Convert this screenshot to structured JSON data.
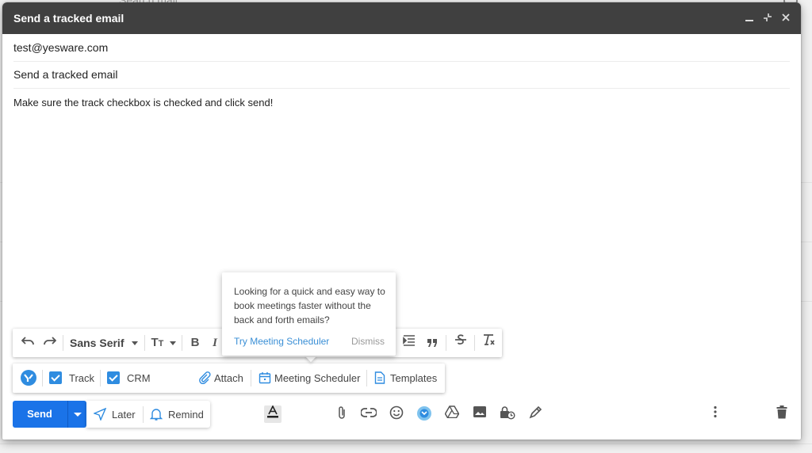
{
  "background": {
    "search_placeholder": "Search mail"
  },
  "compose": {
    "title": "Send a tracked email",
    "to": "test@yesware.com",
    "subject": "Send a tracked email",
    "body": "Make sure the track checkbox is checked and click send!"
  },
  "formatting": {
    "font": "Sans Serif",
    "bold": "B",
    "italic": "I"
  },
  "popup": {
    "text": "Looking for a quick and easy way to book meetings faster without the back and forth emails?",
    "link": "Try Meeting Scheduler",
    "dismiss": "Dismiss"
  },
  "yesware_bar": {
    "track_label": "Track",
    "track_checked": true,
    "crm_label": "CRM",
    "crm_checked": true,
    "attach_label": "Attach",
    "meeting_label": "Meeting Scheduler",
    "templates_label": "Templates"
  },
  "send_bar": {
    "send_label": "Send",
    "later_label": "Later",
    "remind_label": "Remind"
  },
  "colors": {
    "titlebar": "#404040",
    "send": "#1a73e8",
    "checkbox": "#2f8ce0",
    "link": "#3a8fd6"
  },
  "icons": [
    "undo-icon",
    "redo-icon",
    "text-size-icon",
    "indent-icon",
    "quote-icon",
    "strikethrough-icon",
    "clear-format-icon",
    "yesware-logo-icon",
    "paperclip-icon",
    "calendar-icon",
    "document-icon",
    "send-later-icon",
    "bell-icon",
    "text-color-icon",
    "attach-icon",
    "link-icon",
    "emoji-icon",
    "drive-icon",
    "photo-icon",
    "confidential-icon",
    "signature-icon",
    "more-options-icon",
    "trash-icon"
  ]
}
